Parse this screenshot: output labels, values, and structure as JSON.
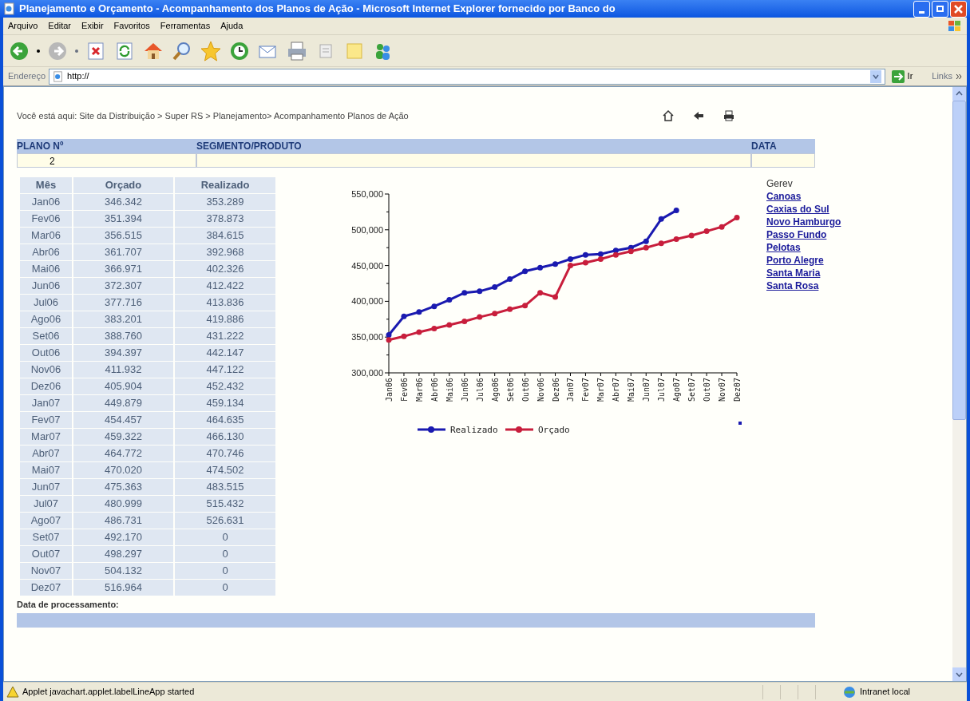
{
  "window": {
    "title": "Planejamento e Orçamento - Acompanhamento dos Planos de Ação - Microsoft Internet Explorer fornecido por Banco do"
  },
  "menu": [
    "Arquivo",
    "Editar",
    "Exibir",
    "Favoritos",
    "Ferramentas",
    "Ajuda"
  ],
  "address": {
    "label": "Endereço",
    "value": "http://",
    "go": "Ir",
    "links": "Links"
  },
  "breadcrumb": "Você está aqui: Site da Distribuição > Super RS > Planejamento> Acompanhamento Planos de Ação",
  "plan_table": {
    "columns": [
      "PLANO Nº",
      "SEGMENTO/PRODUTO",
      "DATA"
    ],
    "plano": "2"
  },
  "data_table": {
    "columns": [
      "Mês",
      "Orçado",
      "Realizado"
    ],
    "rows": [
      [
        "Jan06",
        "346.342",
        "353.289"
      ],
      [
        "Fev06",
        "351.394",
        "378.873"
      ],
      [
        "Mar06",
        "356.515",
        "384.615"
      ],
      [
        "Abr06",
        "361.707",
        "392.968"
      ],
      [
        "Mai06",
        "366.971",
        "402.326"
      ],
      [
        "Jun06",
        "372.307",
        "412.422"
      ],
      [
        "Jul06",
        "377.716",
        "413.836"
      ],
      [
        "Ago06",
        "383.201",
        "419.886"
      ],
      [
        "Set06",
        "388.760",
        "431.222"
      ],
      [
        "Out06",
        "394.397",
        "442.147"
      ],
      [
        "Nov06",
        "411.932",
        "447.122"
      ],
      [
        "Dez06",
        "405.904",
        "452.432"
      ],
      [
        "Jan07",
        "449.879",
        "459.134"
      ],
      [
        "Fev07",
        "454.457",
        "464.635"
      ],
      [
        "Mar07",
        "459.322",
        "466.130"
      ],
      [
        "Abr07",
        "464.772",
        "470.746"
      ],
      [
        "Mai07",
        "470.020",
        "474.502"
      ],
      [
        "Jun07",
        "475.363",
        "483.515"
      ],
      [
        "Jul07",
        "480.999",
        "515.432"
      ],
      [
        "Ago07",
        "486.731",
        "526.631"
      ],
      [
        "Set07",
        "492.170",
        "0"
      ],
      [
        "Out07",
        "498.297",
        "0"
      ],
      [
        "Nov07",
        "504.132",
        "0"
      ],
      [
        "Dez07",
        "516.964",
        "0"
      ]
    ]
  },
  "chart_data": {
    "type": "line",
    "categories": [
      "Jan06",
      "Fev06",
      "Mar06",
      "Abr06",
      "Mai06",
      "Jun06",
      "Jul06",
      "Ago06",
      "Set06",
      "Out06",
      "Nov06",
      "Dez06",
      "Jan07",
      "Fev07",
      "Mar07",
      "Abr07",
      "Mai07",
      "Jun07",
      "Jul07",
      "Ago07",
      "Set07",
      "Out07",
      "Nov07",
      "Dez07"
    ],
    "ylim": [
      300000,
      550000
    ],
    "legend": "bottom",
    "yticks": [
      {
        "value": 300000,
        "label": "300,000"
      },
      {
        "value": 350000,
        "label": "350,000"
      },
      {
        "value": 400000,
        "label": "400,000"
      },
      {
        "value": 450000,
        "label": "450,000"
      },
      {
        "value": 500000,
        "label": "500,000"
      },
      {
        "value": 550000,
        "label": "550,000"
      }
    ],
    "series": [
      {
        "name": "Realizado",
        "color": "#1a1ab0",
        "marker": "circle",
        "values": [
          353000,
          379000,
          385000,
          393000,
          402000,
          412000,
          414000,
          420000,
          431000,
          442000,
          447000,
          452000,
          459000,
          465000,
          466000,
          471000,
          475000,
          484000,
          515000,
          527000,
          null,
          null,
          null,
          null
        ]
      },
      {
        "name": "Orçado",
        "color": "#c81e3c",
        "marker": "circle",
        "values": [
          346000,
          351000,
          357000,
          362000,
          367000,
          372000,
          378000,
          383000,
          389000,
          394000,
          412000,
          406000,
          450000,
          454000,
          459000,
          465000,
          470000,
          475000,
          481000,
          487000,
          492000,
          498000,
          504000,
          517000
        ]
      }
    ]
  },
  "gerev": {
    "title": "Gerev",
    "links": [
      "Canoas",
      "Caxias do Sul",
      "Novo Hamburgo",
      "Passo Fundo",
      "Pelotas",
      "Porto Alegre",
      "Santa Maria",
      "Santa Rosa"
    ]
  },
  "footer_label": "Data de processamento:",
  "status_bar": {
    "message": "Applet javachart.applet.labelLineApp started",
    "zone": "Intranet local"
  }
}
